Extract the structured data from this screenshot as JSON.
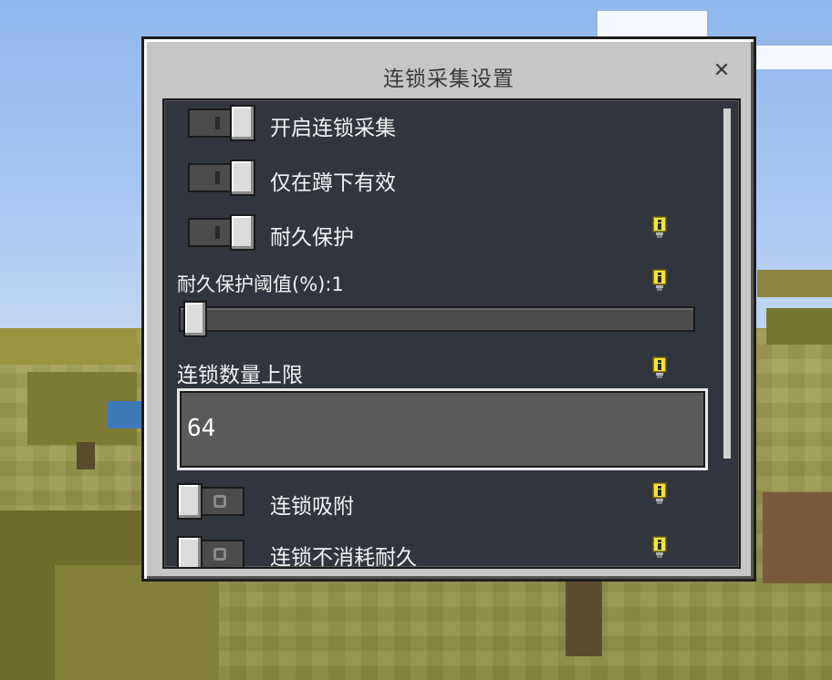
{
  "dialog": {
    "title": "连锁采集设置",
    "close_symbol": "✕"
  },
  "settings": {
    "enable_chain": {
      "label": "开启连锁采集",
      "on": true
    },
    "sneak_only": {
      "label": "仅在蹲下有效",
      "on": true
    },
    "durability_protect": {
      "label": "耐久保护",
      "on": true,
      "info_icon": "info-icon"
    },
    "durability_threshold": {
      "label": "耐久保护阈值(%):1",
      "value": 1,
      "min": 0,
      "max": 100,
      "info_icon": "info-icon"
    },
    "chain_limit": {
      "label": "连锁数量上限",
      "value": "64",
      "info_icon": "info-icon"
    },
    "chain_attract": {
      "label": "连锁吸附",
      "on": false,
      "info_icon": "info-icon"
    },
    "no_durability_cost": {
      "label": "连锁不消耗耐久",
      "on": false,
      "info_icon": "info-icon"
    }
  },
  "colors": {
    "info_yellow": "#f3e43c",
    "panel_bg": "#262a34",
    "dialog_bg": "#c6c6c6"
  }
}
